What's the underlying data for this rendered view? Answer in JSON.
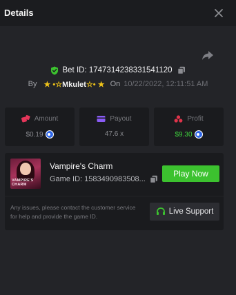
{
  "header": {
    "title": "Details",
    "close_icon": "close-icon"
  },
  "bet": {
    "id_label": "Bet ID:",
    "id_value": "1747314238331541120",
    "by_label": "By",
    "user": "Mkulet",
    "user_decor_left": "★ •☆",
    "user_decor_right": "☆• ★",
    "on_label": "On",
    "date": "10/22/2022, 12:11:51 AM"
  },
  "stats": {
    "amount": {
      "label": "Amount",
      "value": "$0.19",
      "icon": "dice-icon",
      "color": "#e5365a"
    },
    "payout": {
      "label": "Payout",
      "value": "47.6 x",
      "icon": "card-icon",
      "color": "#8a5cf6"
    },
    "profit": {
      "label": "Profit",
      "value": "$9.30",
      "icon": "coins-icon",
      "color": "#e0344b"
    }
  },
  "game": {
    "name": "Vampire's Charm",
    "id_label": "Game ID:",
    "id_value": "1583490983508...",
    "thumb_text": "VAMPIRE'S CHARM",
    "play_label": "Play Now",
    "help_text": "Any issues, please contact the customer service for help and provide the game ID.",
    "support_label": "Live Support"
  },
  "colors": {
    "accent_green": "#3cc22f",
    "profit_green": "#3fd33d",
    "coin_blue": "#2f67e8"
  }
}
